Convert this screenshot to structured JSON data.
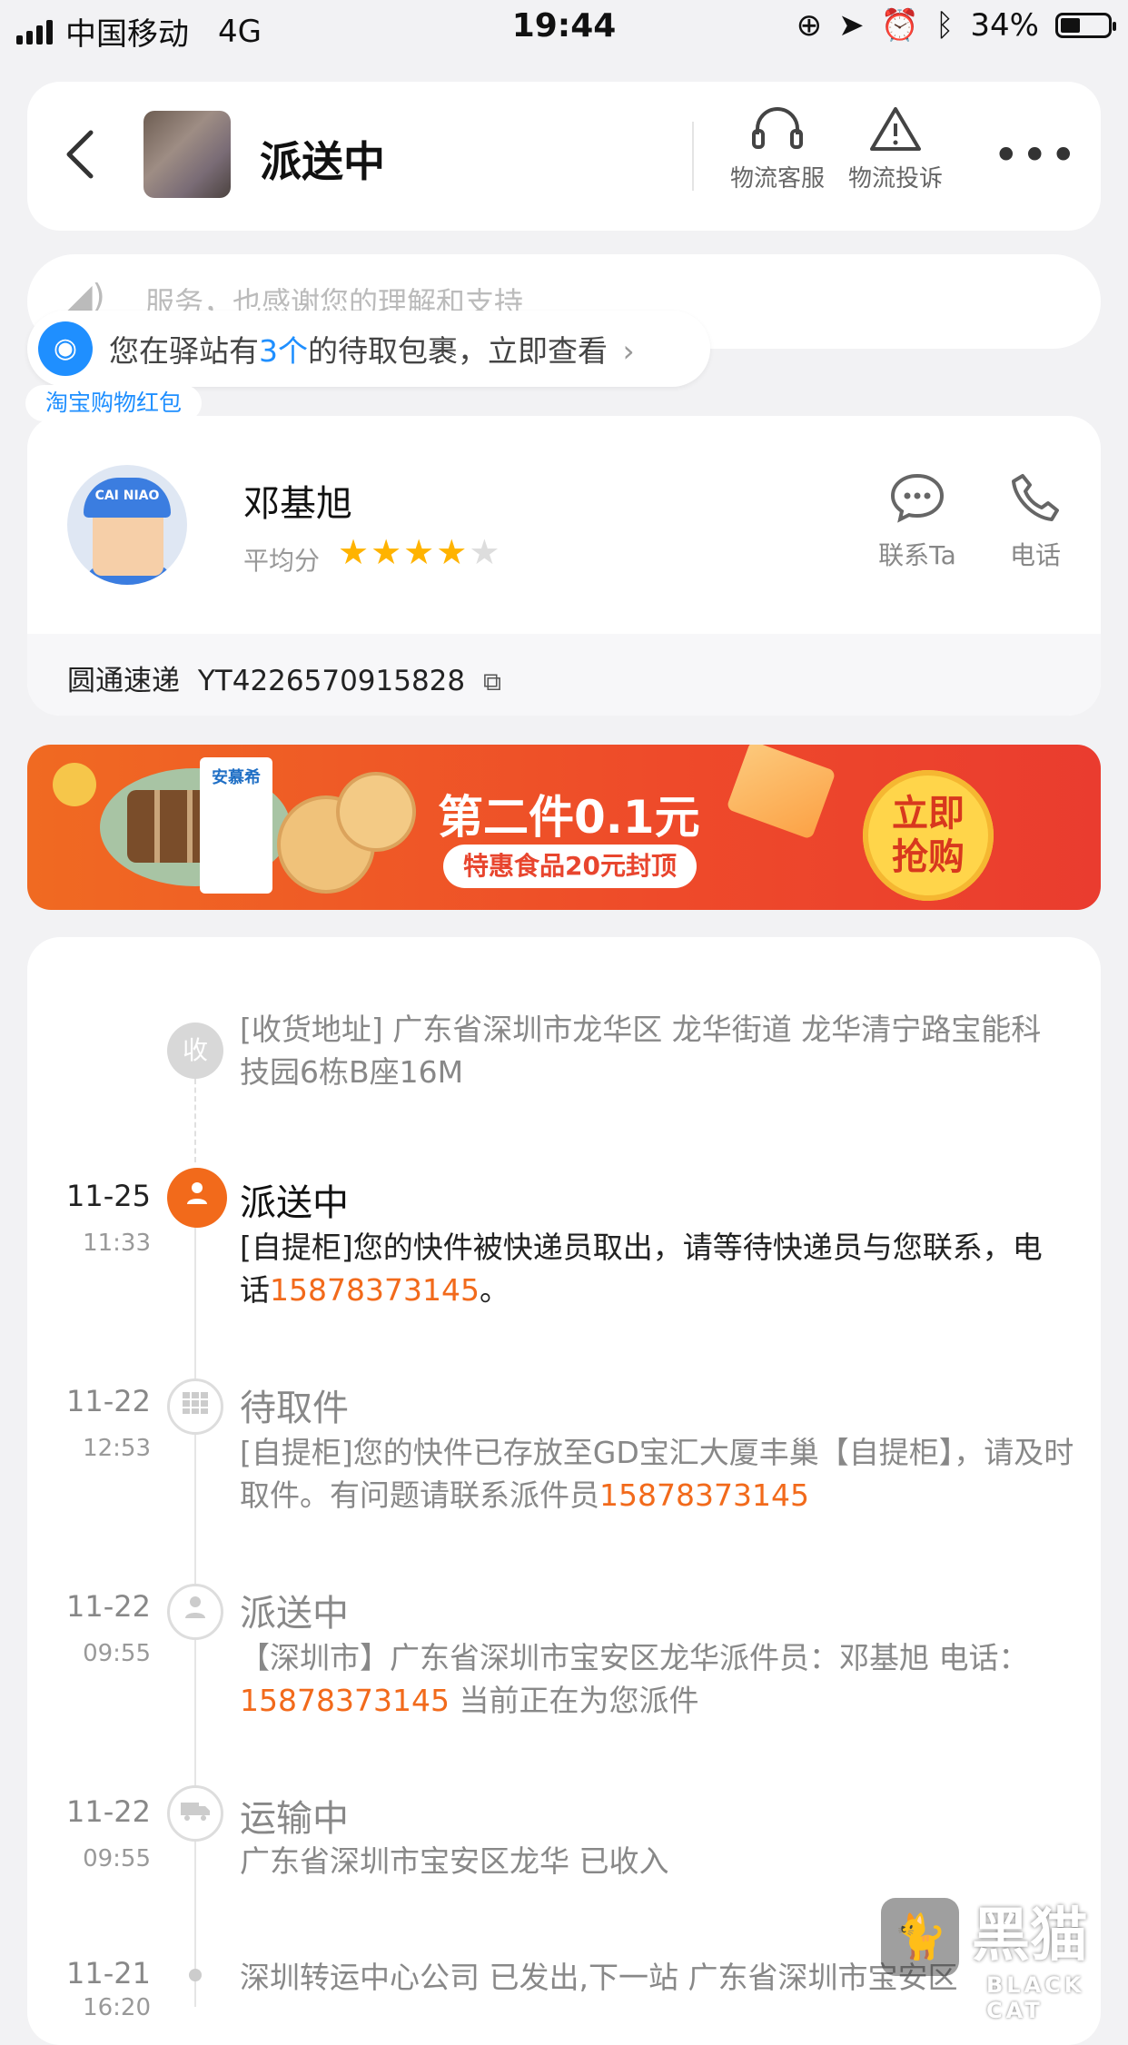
{
  "status_bar": {
    "carrier": "中国移动",
    "network": "4G",
    "time": "19:44",
    "battery": "34%"
  },
  "header": {
    "title": "派送中",
    "service_label": "物流客服",
    "complaint_label": "物流投诉"
  },
  "notice": {
    "text": "服务，也感谢您的理解和支持"
  },
  "pickup": {
    "prefix": "您在驿站有",
    "count": "3个",
    "suffix": "的待取包裹，立即查看"
  },
  "red_packet_label": "淘宝购物红包",
  "courier": {
    "name": "邓基旭",
    "score_label": "平均分",
    "rating": 4,
    "rating_max": 5,
    "contact_label": "联系Ta",
    "phone_label": "电话",
    "avatar_cap_text": "CAI NIAO",
    "company": "圆通速递",
    "tracking_no": "YT4226570915828"
  },
  "banner": {
    "title": "第二件0.1元",
    "subtitle": "特惠食品20元封顶",
    "button_line1": "立即",
    "button_line2": "抢购",
    "product_label": "安慕希"
  },
  "timeline": {
    "address": {
      "node_label": "收",
      "text": "[收货地址] 广东省深圳市龙华区  龙华街道   龙华清宁路宝能科技园6栋B座16M"
    },
    "events": [
      {
        "date": "11-25",
        "time": "11:33",
        "status": "派送中",
        "desc_prefix": "[自提柜]您的快件被快递员取出，请等待快递员与您联系，电话",
        "phone": "15878373145",
        "desc_suffix": "。"
      },
      {
        "date": "11-22",
        "time": "12:53",
        "status": "待取件",
        "desc_prefix": "[自提柜]您的快件已存放至GD宝汇大厦丰巢【自提柜】，请及时取件。有问题请联系派件员",
        "phone": "15878373145",
        "desc_suffix": ""
      },
      {
        "date": "11-22",
        "time": "09:55",
        "status": "派送中",
        "desc_prefix": "【深圳市】广东省深圳市宝安区龙华派件员：邓基旭 电话： ",
        "phone": "15878373145",
        "desc_suffix": " 当前正在为您派件"
      },
      {
        "date": "11-22",
        "time": "09:55",
        "status": "运输中",
        "desc_prefix": "广东省深圳市宝安区龙华 已收入",
        "phone": "",
        "desc_suffix": ""
      },
      {
        "date": "11-21",
        "time": "16:20",
        "status": "",
        "desc_prefix": "深圳转运中心公司 已发出,下一站 广东省深圳市宝安区",
        "phone": "",
        "desc_suffix": ""
      }
    ]
  },
  "watermark": {
    "big": "黑猫",
    "small": "BLACK CAT"
  },
  "colors": {
    "accent_orange": "#f26a1b",
    "link_blue": "#1f8fff",
    "star": "#ffb300"
  }
}
